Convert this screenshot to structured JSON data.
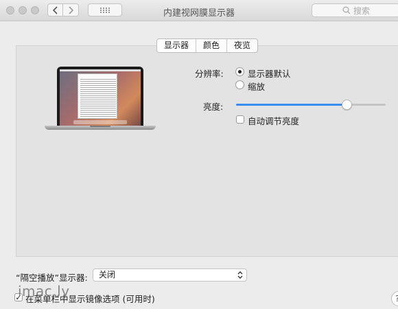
{
  "window": {
    "title": "内建视网膜显示器"
  },
  "search": {
    "placeholder": "搜索",
    "icon": "search-icon"
  },
  "tabs": [
    {
      "label": "显示器",
      "selected": true
    },
    {
      "label": "颜色",
      "selected": false
    },
    {
      "label": "夜览",
      "selected": false
    }
  ],
  "resolution": {
    "label": "分辨率:",
    "options": [
      {
        "label": "显示器默认",
        "selected": true
      },
      {
        "label": "缩放",
        "selected": false
      }
    ]
  },
  "brightness": {
    "label": "亮度:",
    "value_fraction": 0.74,
    "auto_label": "自动调节亮度",
    "auto_checked": false
  },
  "airplay": {
    "label": "“隔空播放”显示器:",
    "selected": "关闭"
  },
  "mirroring": {
    "label": "在菜单栏中显示镜像选项 (可用时)",
    "checked": true
  },
  "watermark": {
    "text": "imac.ly"
  },
  "help": {
    "label": "?"
  },
  "colors": {
    "accent": "#3a8cf0",
    "background": "#ececec",
    "panel": "#e3e3e3"
  }
}
